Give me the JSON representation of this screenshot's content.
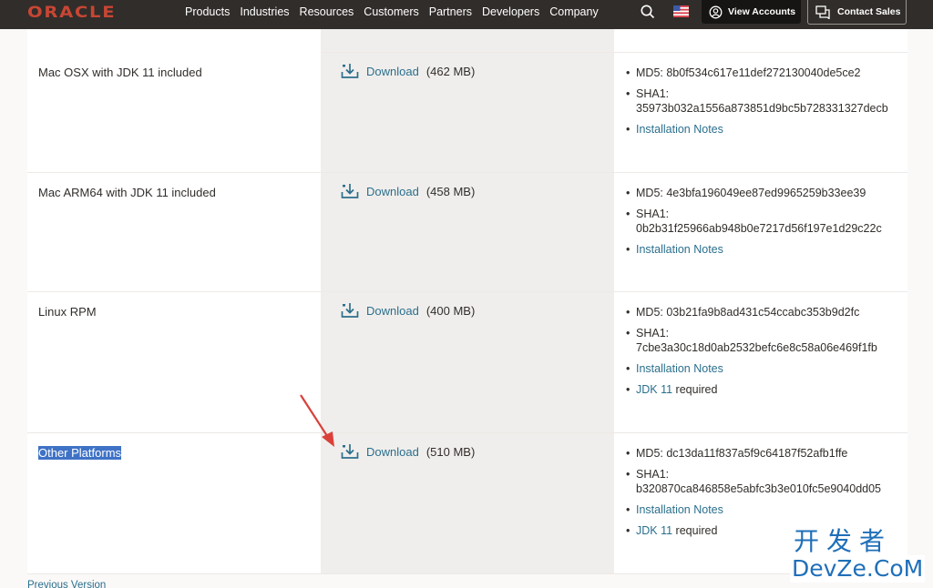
{
  "header": {
    "logo": "ORACLE",
    "nav": [
      "Products",
      "Industries",
      "Resources",
      "Customers",
      "Partners",
      "Developers",
      "Company"
    ],
    "view_accounts": "View Accounts",
    "contact_sales": "Contact Sales",
    "icons": {
      "search": "search-icon",
      "flag": "us-flag-icon",
      "account": "user-circle-icon",
      "chat": "chat-icon"
    }
  },
  "rows": [
    {
      "name": "Mac OSX with JDK 11 included",
      "download_label": "Download",
      "size": "(462 MB)",
      "md5": "MD5: 8b0f534c617e11def272130040de5ce2",
      "sha1_label": "SHA1:",
      "sha1": "35973b032a1556a873851d9bc5b728331327decb",
      "notes": "Installation Notes"
    },
    {
      "name": "Mac ARM64 with JDK 11 included",
      "download_label": "Download",
      "size": "(458 MB)",
      "md5": "MD5: 4e3bfa196049ee87ed9965259b33ee39",
      "sha1_label": "SHA1:",
      "sha1": "0b2b31f25966ab948b0e7217d56f197e1d29c22c",
      "notes": "Installation Notes"
    },
    {
      "name": "Linux RPM",
      "download_label": "Download",
      "size": "(400 MB)",
      "md5": "MD5: 03b21fa9b8ad431c54ccabc353b9d2fc",
      "sha1_label": "SHA1:",
      "sha1": "7cbe3a30c18d0ab2532befc6e8c58a06e469f1fb",
      "notes": "Installation Notes",
      "jdk_link": "JDK 11",
      "jdk_suffix": " required"
    },
    {
      "name": "Other Platforms",
      "download_label": "Download",
      "size": "(510 MB)",
      "md5": "MD5: dc13da11f837a5f9c64187f52afb1ffe",
      "sha1_label": "SHA1:",
      "sha1": "b320870ca846858e5abfc3b3e010fc5e9040dd05",
      "notes": "Installation Notes",
      "jdk_link": "JDK 11",
      "jdk_suffix": " required"
    }
  ],
  "footer": {
    "previous_version": "Previous Version"
  },
  "watermark": {
    "cn": "开发者",
    "en": "DevZe.CoM"
  },
  "colors": {
    "brand": "#c74634",
    "link": "#2b6f8d",
    "nav_bg": "#312d2a",
    "selection": "#3f72c6",
    "annotation_arrow": "#d9413a"
  }
}
